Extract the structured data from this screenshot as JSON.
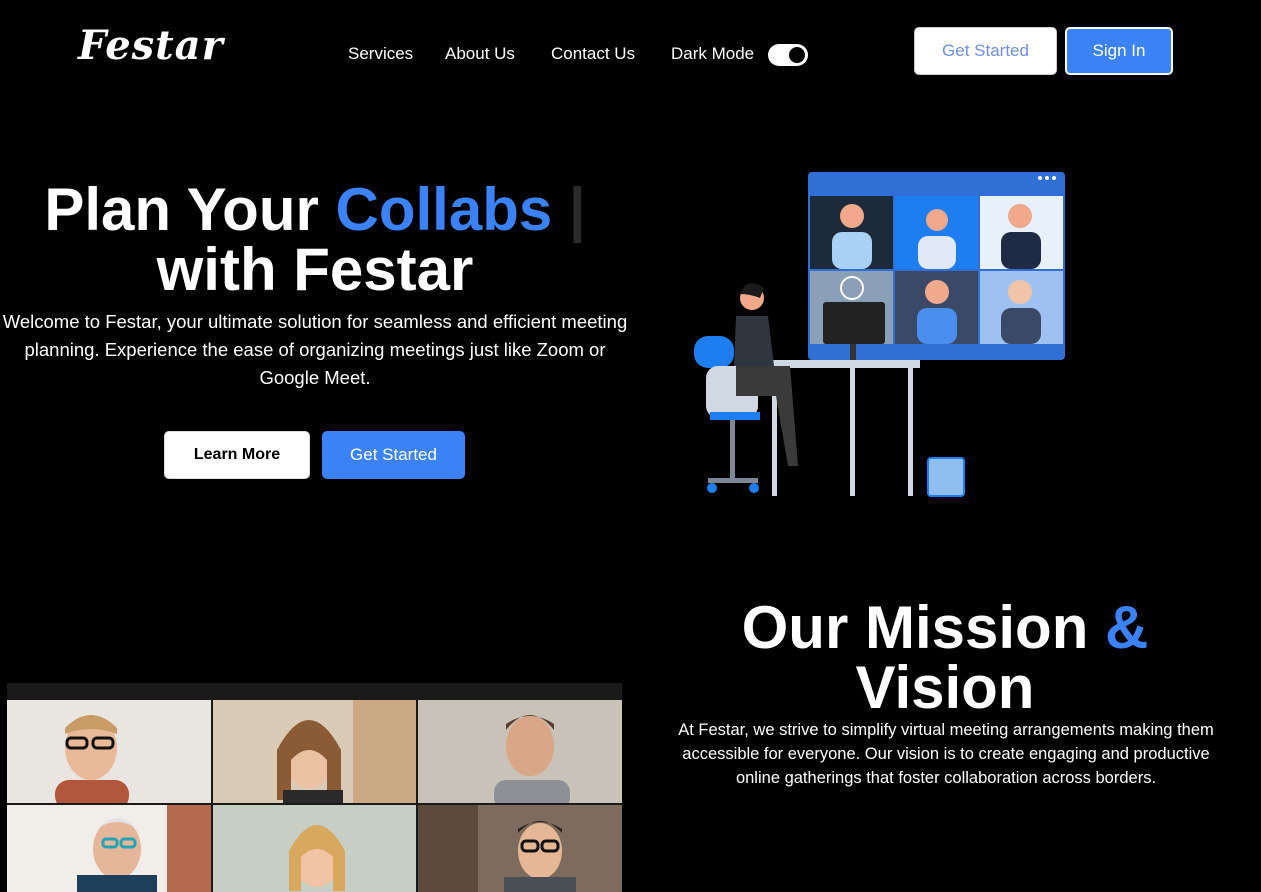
{
  "nav": {
    "logo": "Festar",
    "links": [
      "Services",
      "About Us",
      "Contact Us",
      "Dark Mode"
    ],
    "dark_mode_on": true,
    "get_started": "Get Started",
    "sign_in": "Sign In"
  },
  "hero": {
    "title_part1": "Plan Your ",
    "title_accent": "Collabs",
    "title_cursor": "|",
    "title_line2": "with Festar",
    "subtitle": "Welcome to Festar, your ultimate solution for seamless and efficient meeting planning. Experience the ease of organizing meetings just like Zoom or Google Meet.",
    "learn_more": "Learn More",
    "get_started": "Get Started"
  },
  "mission": {
    "title_part1": "Our Mission ",
    "title_accent": "&",
    "title_line2": "Vision",
    "text": "At Festar, we strive to simplify virtual meeting arrangements making them accessible for everyone. Our vision is to create engaging and productive online gatherings that foster collaboration across borders."
  },
  "colors": {
    "accent": "#3b82f6",
    "background": "#000000"
  }
}
